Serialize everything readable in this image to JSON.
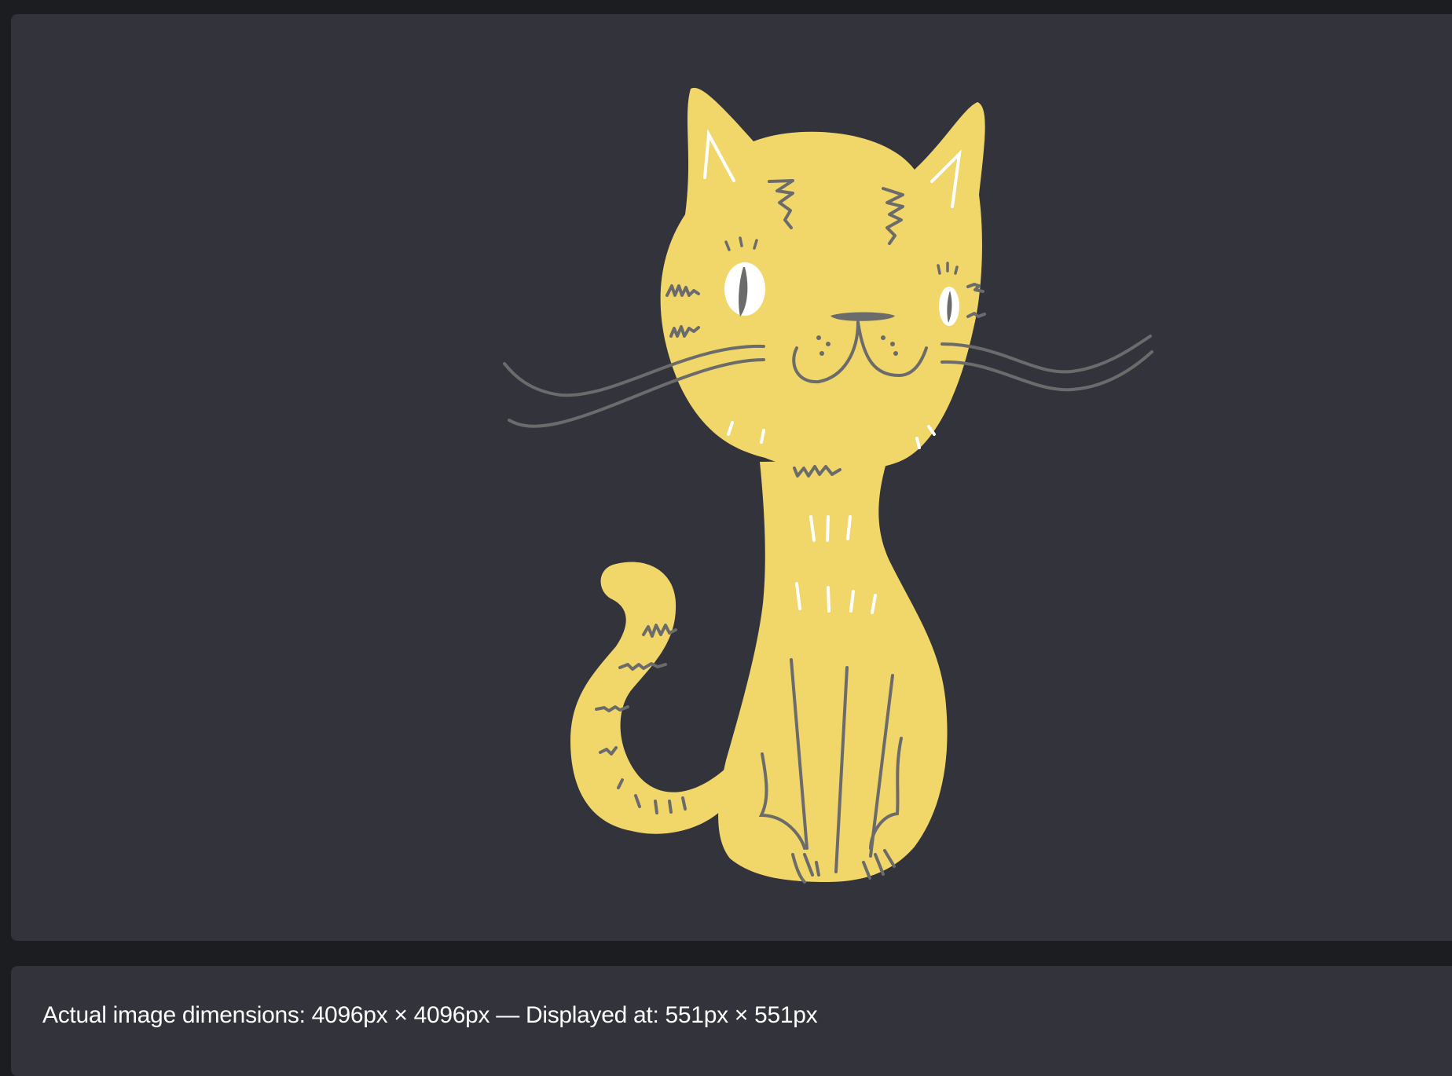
{
  "info": {
    "dimensions_text": "Actual image dimensions: 4096px × 4096px — Displayed at: 551px × 551px"
  },
  "image": {
    "subject": "cat-illustration",
    "colors": {
      "background": "#32333b",
      "body": "#f1d66a",
      "stroke": "#6b6b6b",
      "highlight": "#ffffff"
    }
  }
}
